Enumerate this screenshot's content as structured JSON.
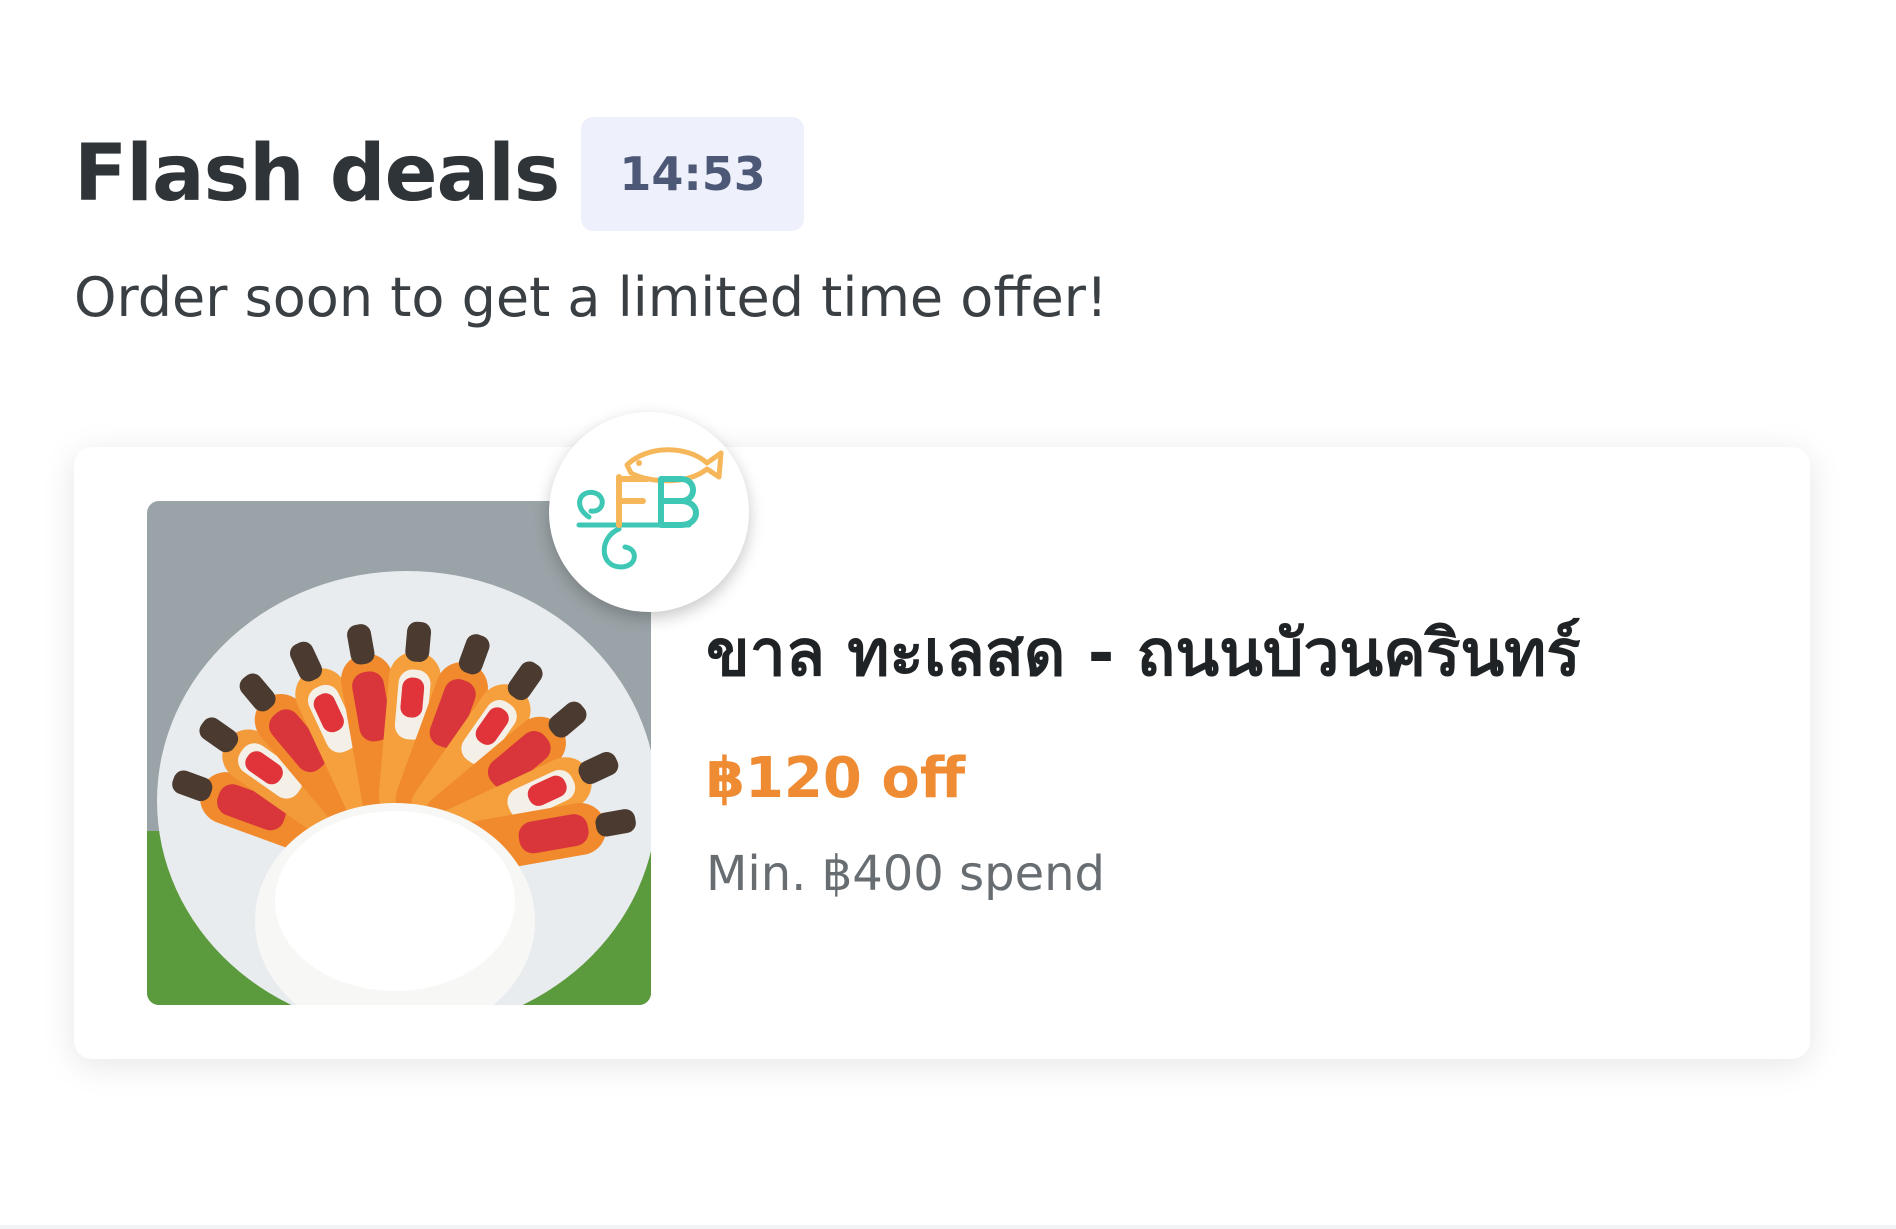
{
  "section": {
    "title": "Flash deals",
    "timer": "14:53",
    "subtitle": "Order soon to get a limited time offer!"
  },
  "deal": {
    "restaurant_name": "ขาล ทะเลสด - ถนนบัวนครินทร์",
    "discount": "฿120 off",
    "min_spend": "Min. ฿400 spend",
    "logo_text": "FB",
    "image": "grilled-prawns-with-rice"
  },
  "colors": {
    "title": "#2f3438",
    "timer_bg": "#eef1fb",
    "timer_text": "#4d5876",
    "discount": "#ef8b32",
    "logo_teal": "#3ec7b4",
    "logo_orange": "#f6b75a"
  }
}
